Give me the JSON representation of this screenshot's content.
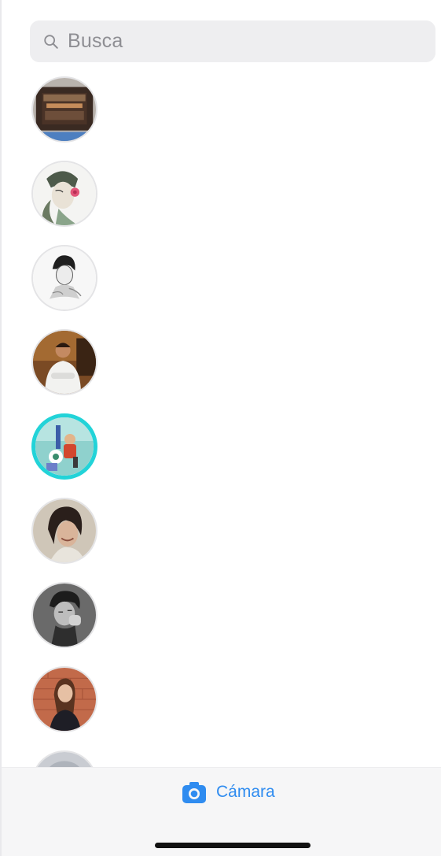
{
  "search": {
    "placeholder": "Busca"
  },
  "header_faint": "",
  "contacts": [
    {
      "avatar_type": "photo",
      "has_story": false
    },
    {
      "avatar_type": "illustration",
      "has_story": false
    },
    {
      "avatar_type": "illustration",
      "has_story": false
    },
    {
      "avatar_type": "photo",
      "has_story": false
    },
    {
      "avatar_type": "illustration",
      "has_story": true
    },
    {
      "avatar_type": "photo",
      "has_story": false
    },
    {
      "avatar_type": "photo",
      "has_story": false
    },
    {
      "avatar_type": "photo",
      "has_story": false
    },
    {
      "avatar_type": "photo",
      "has_story": false
    }
  ],
  "bottom_bar": {
    "camera_label": "Cámara",
    "camera_icon": "camera-icon"
  },
  "colors": {
    "accent": "#2f8cf0",
    "story_ring": "#22d3d8"
  }
}
